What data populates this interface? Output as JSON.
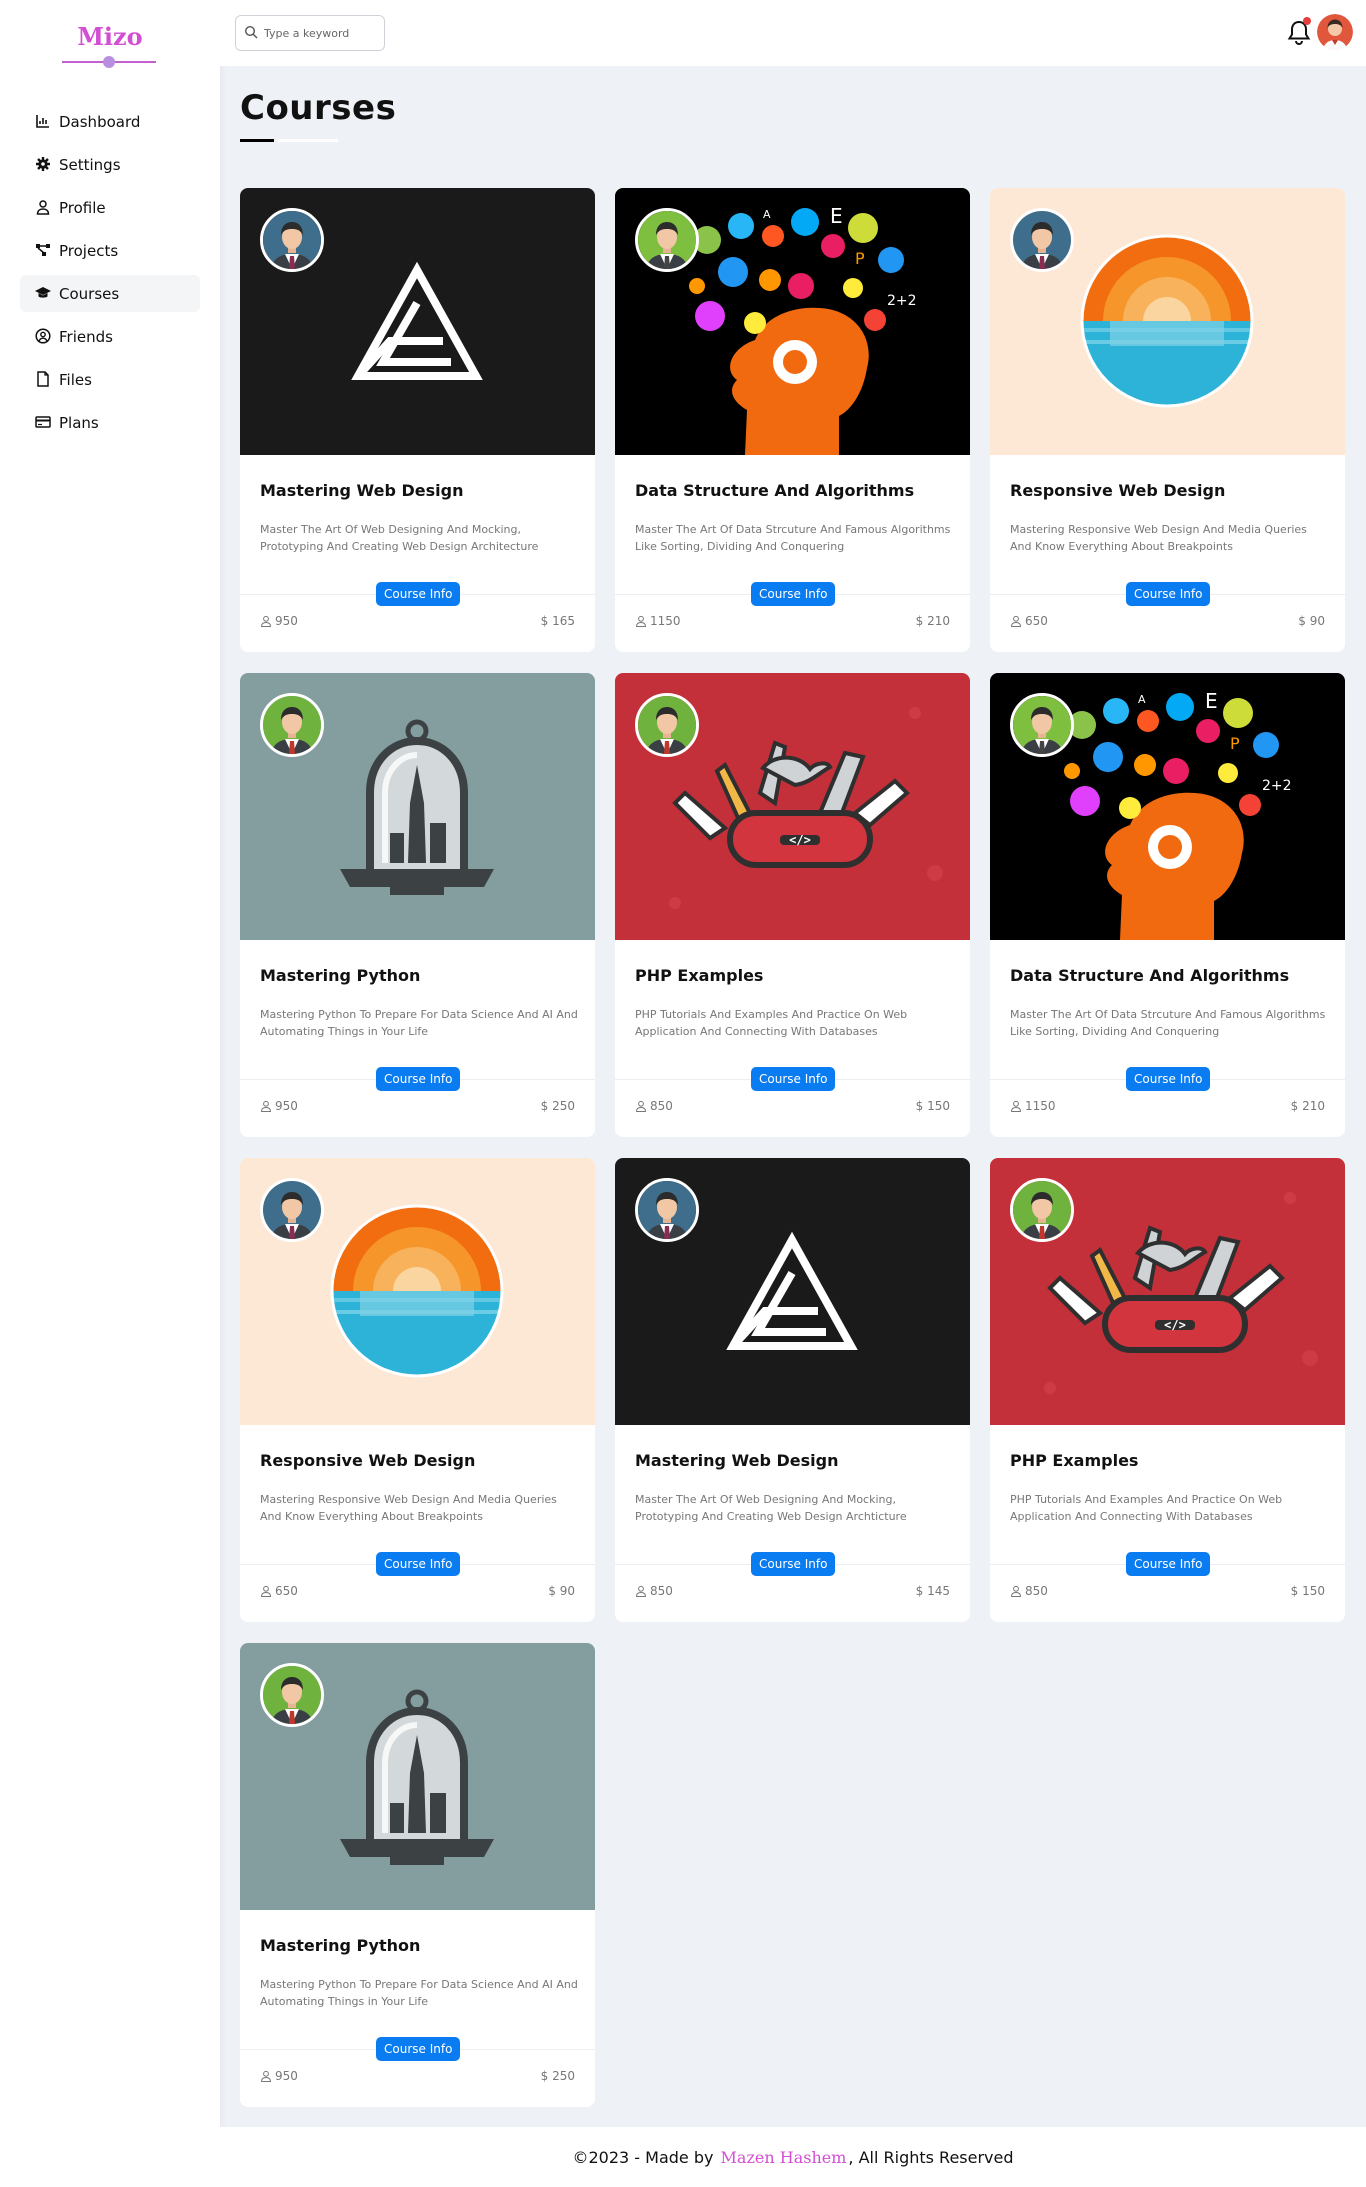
{
  "brand": {
    "name": "Mizo",
    "color": "#d24fd4"
  },
  "sidebar": {
    "items": [
      {
        "label": "Dashboard",
        "icon": "chart-icon",
        "active": false
      },
      {
        "label": "Settings",
        "icon": "gear-icon",
        "active": false
      },
      {
        "label": "Profile",
        "icon": "user-icon",
        "active": false
      },
      {
        "label": "Projects",
        "icon": "diagram-icon",
        "active": false
      },
      {
        "label": "Courses",
        "icon": "graduation-cap-icon",
        "active": true
      },
      {
        "label": "Friends",
        "icon": "circle-user-icon",
        "active": false
      },
      {
        "label": "Files",
        "icon": "file-icon",
        "active": false
      },
      {
        "label": "Plans",
        "icon": "credit-card-icon",
        "active": false
      }
    ]
  },
  "header": {
    "search_placeholder": "Type a keyword",
    "notification_icon": "bell-icon",
    "notification_dot_color": "#e43d3d"
  },
  "page": {
    "title": "Courses"
  },
  "button_color": "#0a7cf2",
  "courses": [
    {
      "title": "Mastering Web Design",
      "description": "Master The Art Of Web Designing And Mocking, Prototyping And Creating Web Design Architecture",
      "button": "Course Info",
      "students": "950",
      "price": "$ 165",
      "image": "triangle-logo",
      "avatar": "man-blue"
    },
    {
      "title": "Data Structure And Algorithms",
      "description": "Master The Art Of Data Strcuture And Famous Algorithms Like Sorting, Dividing And Conquering",
      "button": "Course Info",
      "students": "1150",
      "price": "$ 210",
      "image": "brain-science",
      "avatar": "woman-green"
    },
    {
      "title": "Responsive Web Design",
      "description": "Mastering Responsive Web Design And Media Queries And Know Everything About Breakpoints",
      "button": "Course Info",
      "students": "650",
      "price": "$ 90",
      "image": "sunset-circle",
      "avatar": "man-blue"
    },
    {
      "title": "Mastering Python",
      "description": "Mastering Python To Prepare For Data Science And AI And Automating Things in Your Life",
      "button": "Course Info",
      "students": "950",
      "price": "$ 250",
      "image": "bell-jar-city",
      "avatar": "man-green"
    },
    {
      "title": "PHP Examples",
      "description": "PHP Tutorials And Examples And Practice On Web Application And Connecting With Databases",
      "button": "Course Info",
      "students": "850",
      "price": "$ 150",
      "image": "swiss-knife-code",
      "avatar": "man-green"
    },
    {
      "title": "Data Structure And Algorithms",
      "description": "Master The Art Of Data Strcuture And Famous Algorithms Like Sorting, Dividing And Conquering",
      "button": "Course Info",
      "students": "1150",
      "price": "$ 210",
      "image": "brain-science",
      "avatar": "woman-green"
    },
    {
      "title": "Responsive Web Design",
      "description": "Mastering Responsive Web Design And Media Queries And Know Everything About Breakpoints",
      "button": "Course Info",
      "students": "650",
      "price": "$ 90",
      "image": "sunset-circle",
      "avatar": "man-blue"
    },
    {
      "title": "Mastering Web Design",
      "description": "Master The Art Of Web Designing And Mocking, Prototyping And Creating Web Design Archticture",
      "button": "Course Info",
      "students": "850",
      "price": "$ 145",
      "image": "triangle-logo",
      "avatar": "man-blue"
    },
    {
      "title": "PHP Examples",
      "description": "PHP Tutorials And Examples And Practice On Web Application And Connecting With Databases",
      "button": "Course Info",
      "students": "850",
      "price": "$ 150",
      "image": "swiss-knife-code",
      "avatar": "man-green"
    },
    {
      "title": "Mastering Python",
      "description": "Mastering Python To Prepare For Data Science And AI And Automating Things in Your Life",
      "button": "Course Info",
      "students": "950",
      "price": "$ 250",
      "image": "bell-jar-city",
      "avatar": "man-green"
    }
  ],
  "footer": {
    "prefix": "©2023 - Made by",
    "author": "Mazen Hashem",
    "suffix": ", All Rights Reserved"
  }
}
